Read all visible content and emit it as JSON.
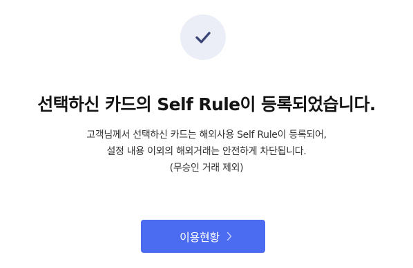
{
  "confirmation": {
    "icon": "check-icon",
    "title": "선택하신 카드의 Self Rule이 등록되었습니다.",
    "description_lines": [
      "고객님께서 선택하신 카드는 해외사용 Self Rule이 등록되어,",
      "설정 내용 이외의 해외거래는 안전하게 차단됩니다.",
      "(무승인 거래 제외)"
    ]
  },
  "actions": {
    "status_button_label": "이용현황",
    "status_button_icon": "chevron-right-icon"
  },
  "colors": {
    "accent": "#4b6bf0",
    "icon_circle_bg": "#eceef7",
    "icon_stroke": "#3a4675"
  }
}
